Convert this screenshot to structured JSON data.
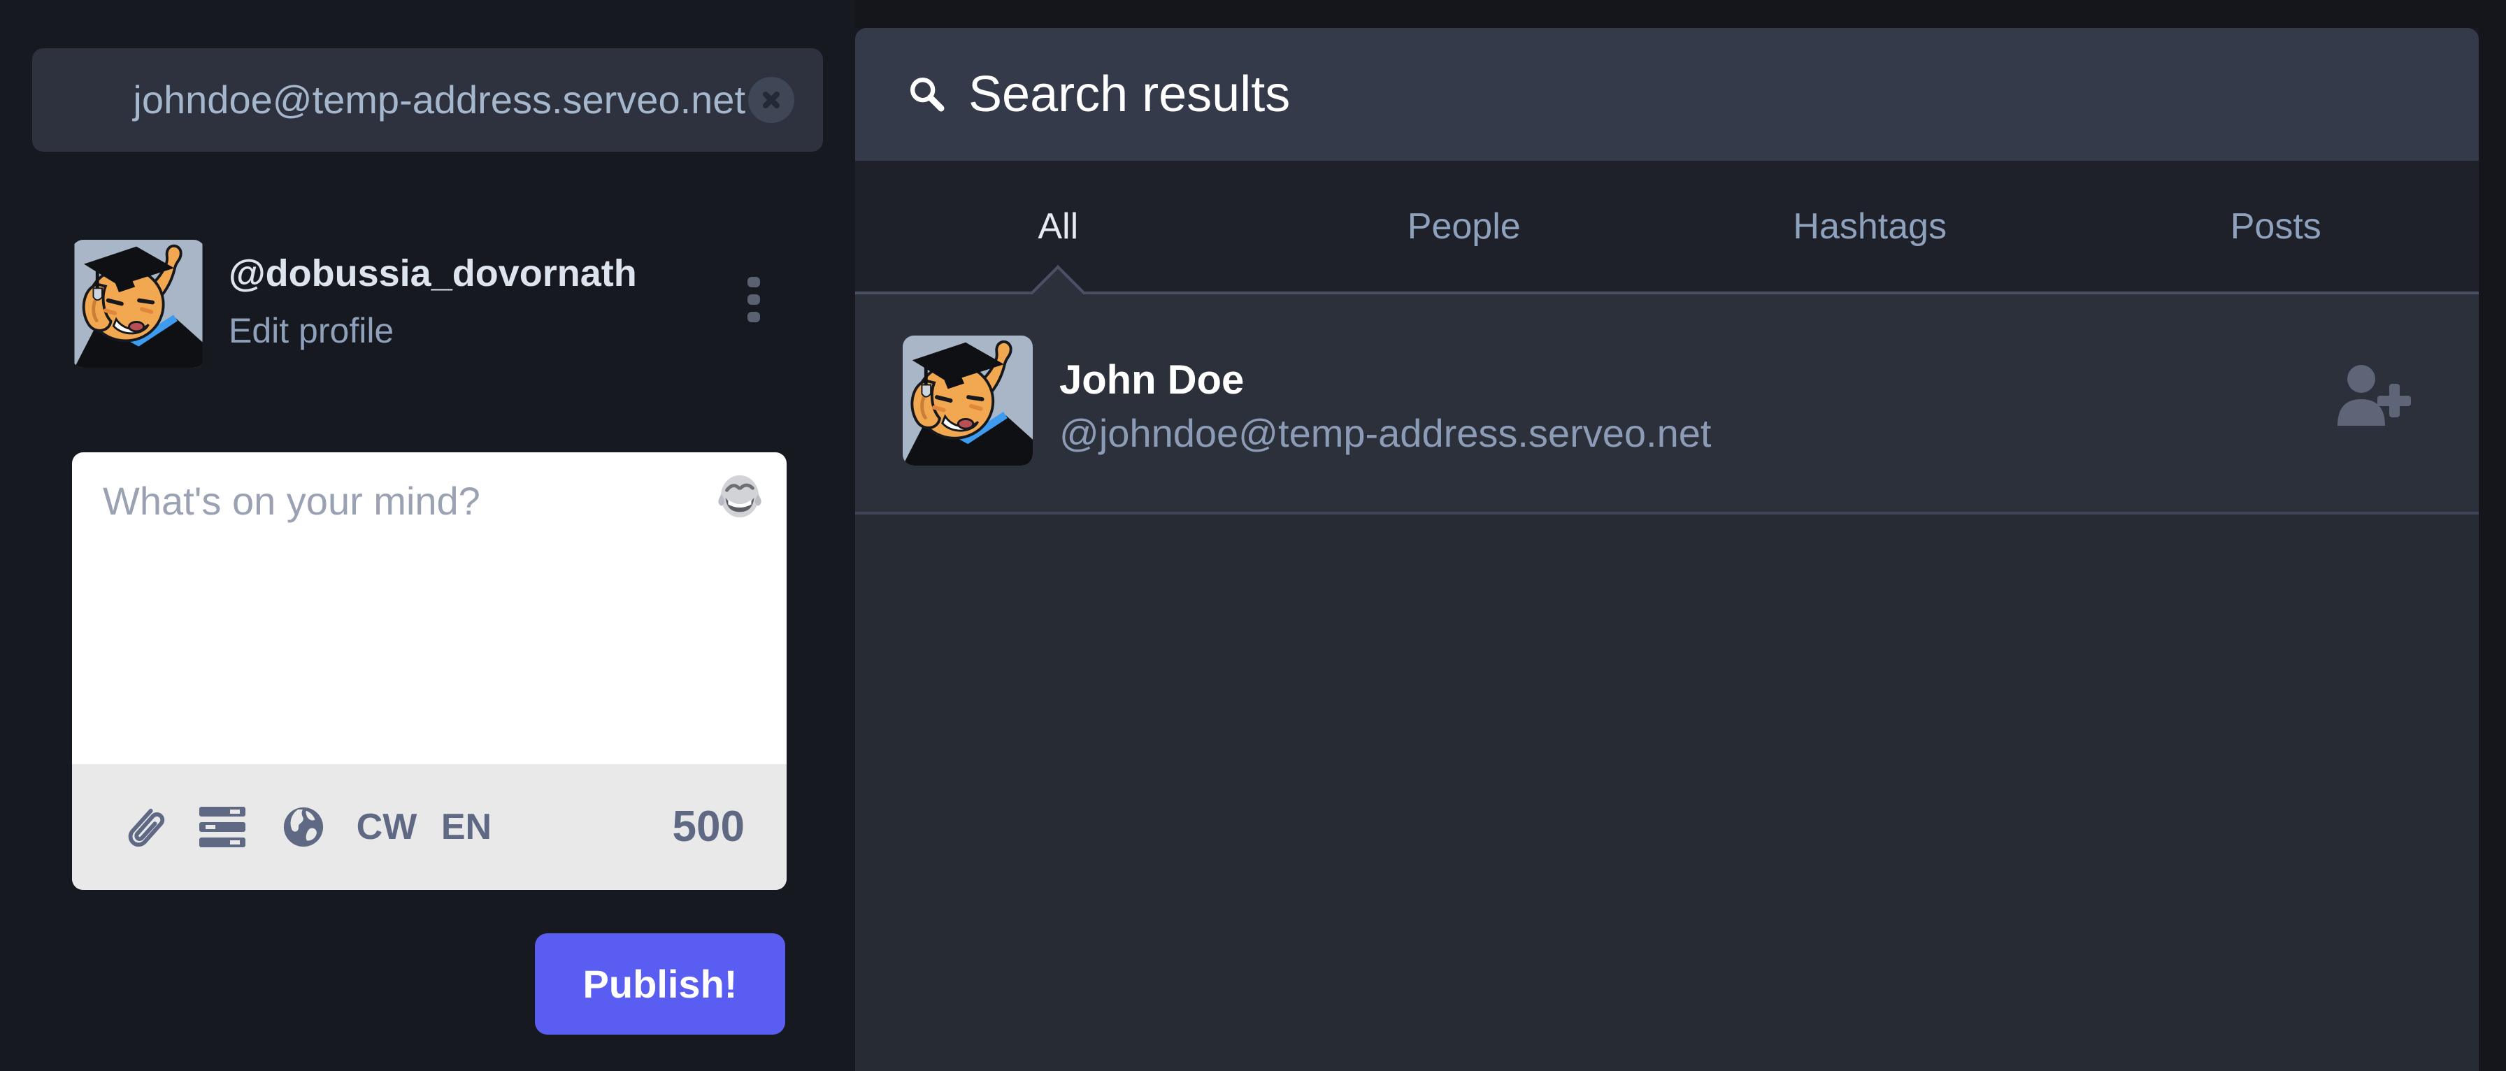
{
  "accent_color": "#5a5df2",
  "left_column": {
    "search": {
      "value": "johndoe@temp-address.serveo.net",
      "clear_icon": "x-circle-icon"
    },
    "profile": {
      "handle": "@dobussia_dovornath",
      "edit_profile": "Edit profile",
      "menu_icon": "kebab-vertical-icon"
    },
    "composer": {
      "placeholder": "What's on your mind?",
      "emoji_icon": "joy-emoji-grayscale",
      "toolbar": {
        "attach_icon": "paperclip",
        "poll_icon": "poll-bars",
        "privacy_icon": "globe",
        "cw": "CW",
        "language": "EN",
        "char_count": "500"
      },
      "publish": "Publish!"
    }
  },
  "search_panel": {
    "title": "Search results",
    "title_icon": "magnifier",
    "tabs": [
      {
        "label": "All",
        "active": true
      },
      {
        "label": "People",
        "active": false
      },
      {
        "label": "Hashtags",
        "active": false
      },
      {
        "label": "Posts",
        "active": false
      }
    ],
    "results": [
      {
        "display_name": "John Doe",
        "handle": "@johndoe@temp-address.serveo.net",
        "action_icon": "person-add"
      }
    ]
  }
}
